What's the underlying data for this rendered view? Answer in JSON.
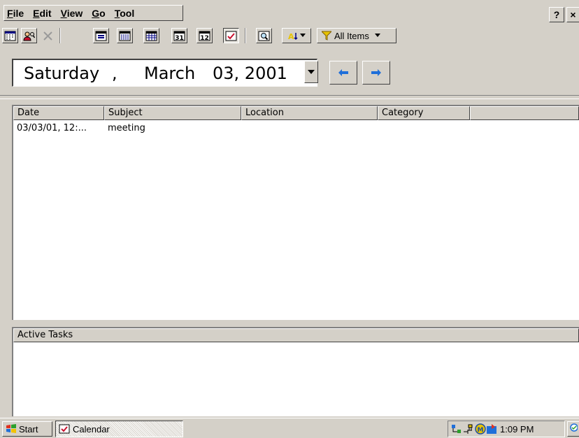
{
  "menubar": {
    "items": [
      {
        "accel": "F",
        "rest": "ile"
      },
      {
        "accel": "E",
        "rest": "dit"
      },
      {
        "accel": "V",
        "rest": "iew"
      },
      {
        "accel": "G",
        "rest": "o"
      },
      {
        "accel": "T",
        "rest": "ool"
      }
    ],
    "help_label": "?",
    "close_label": "×"
  },
  "toolbar": {
    "icons": [
      "calendar-new-icon",
      "find-person-icon",
      "delete-icon",
      "day-view-icon",
      "week-view-icon",
      "month-view-icon",
      "date-31-icon",
      "date-12-icon",
      "list-view-icon",
      "find-icon",
      "sort-icon",
      "filter-icon"
    ],
    "filter_label": "All Items"
  },
  "date_bar": {
    "weekday": "Saturday",
    "comma": ",",
    "month": "March",
    "day_year": "03, 2001"
  },
  "list": {
    "columns": [
      "Date",
      "Subject",
      "Location",
      "Category",
      ""
    ],
    "rows": [
      {
        "date": "03/03/01, 12:...",
        "subject": "meeting",
        "location": "",
        "category": ""
      }
    ]
  },
  "tasks": {
    "header": "Active Tasks"
  },
  "taskbar": {
    "start_label": "Start",
    "task_label": "Calendar",
    "clock": "1:09 PM"
  },
  "colors": {
    "face": "#d4d0c8",
    "arrow_blue": "#1f6fd9",
    "filter_yellow": "#e8c400"
  }
}
